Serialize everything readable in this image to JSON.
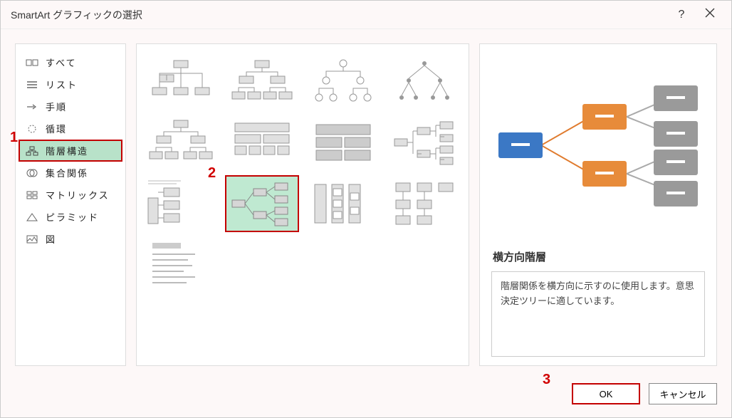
{
  "titlebar": {
    "title": "SmartArt グラフィックの選択"
  },
  "sidebar": {
    "items": [
      {
        "label": "すべて"
      },
      {
        "label": "リスト"
      },
      {
        "label": "手順"
      },
      {
        "label": "循環"
      },
      {
        "label": "階層構造"
      },
      {
        "label": "集合関係"
      },
      {
        "label": "マトリックス"
      },
      {
        "label": "ピラミッド"
      },
      {
        "label": "図"
      }
    ]
  },
  "preview": {
    "title": "横方向階層",
    "description": "階層関係を横方向に示すのに使用します。意思決定ツリーに適しています。"
  },
  "footer": {
    "ok": "OK",
    "cancel": "キャンセル"
  },
  "annotations": {
    "a1": "1",
    "a2": "2",
    "a3": "3"
  }
}
